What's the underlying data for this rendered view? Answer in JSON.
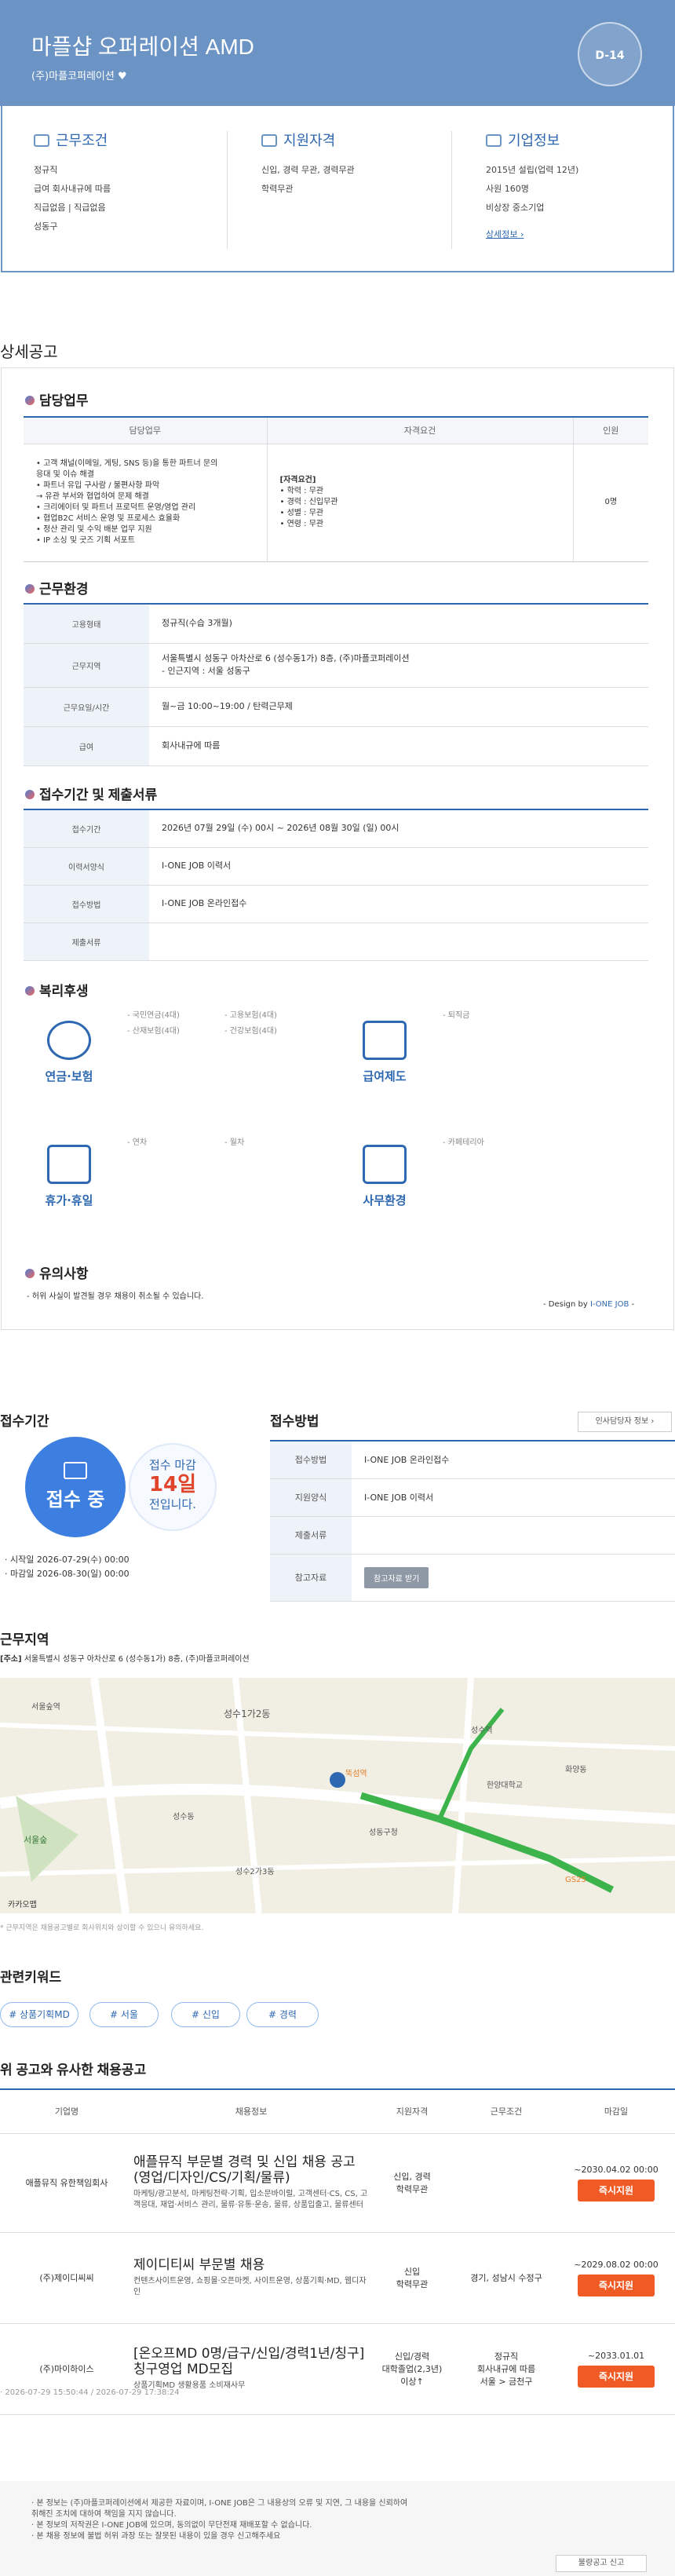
{
  "header": {
    "title": "마플샵 오퍼레이션 AMD",
    "company": "(주)마플코퍼레이션",
    "dday": "D-14"
  },
  "summary": {
    "work": {
      "title": "근무조건",
      "items": [
        "정규직",
        "급여 회사내규에 따름",
        "직급없음 | 직급없음",
        "성동구"
      ]
    },
    "qual": {
      "title": "지원자격",
      "items": [
        "신입, 경력 무관, 경력무관",
        "학력무관"
      ]
    },
    "corp": {
      "title": "기업정보",
      "items": [
        "2015년 설립(업력 12년)",
        "사원 160명",
        "비상장 중소기업"
      ],
      "link": "상세정보 ›"
    }
  },
  "detail_title": "상세공고",
  "duty": {
    "title": "담당업무",
    "headers": [
      "담당업무",
      "자격요건",
      "인원"
    ],
    "tasks": [
      "• 고객 채널(이메일, 게팅, SNS 등)을 통한 파트너 문의",
      "  응대 및 이슈 해결",
      "• 파트너 유입 구사람 / 불편사항 파악",
      "  → 유관 부서와 협업하여 문제 해결",
      "• 크리에이터 및 파트너 프로덕트 운영/영업 관리",
      "• 협업B2C 서비스 운영 및 프로세스 효율화",
      "• 정산 관리 및 수익 배분 업무 지원",
      "• IP 소싱 및 굿즈 기획 서포트"
    ],
    "reqs": [
      "[자격요건]",
      "• 학력 : 무관",
      "• 경력 : 신입무관",
      "• 성별 : 무관",
      "• 연령 : 무관"
    ],
    "count": "0명"
  },
  "env": {
    "title": "근무환경",
    "rows": [
      {
        "k": "고용형태",
        "v": "정규직(수습 3개월)"
      },
      {
        "k": "근무지역",
        "v": "서울특별시 성동구 아차산로 6 (성수동1가) 8층, (주)마플코퍼레이션",
        "v2": "- 인근지역 : 서울 성동구"
      },
      {
        "k": "근무요일/시간",
        "v": "월~금 10:00~19:00 / 탄력근무제"
      },
      {
        "k": "급여",
        "v": "회사내규에 따름"
      }
    ]
  },
  "period": {
    "title": "접수기간 및 제출서류",
    "rows": [
      {
        "k": "접수기간",
        "v": "2026년 07월 29일 (수) 00시 ~ 2026년 08월 30일 (일) 00시"
      },
      {
        "k": "이력서양식",
        "v": "I-ONE JOB 이력서"
      },
      {
        "k": "접수방법",
        "v": "I-ONE JOB 온라인접수"
      },
      {
        "k": "제출서류",
        "v": ""
      }
    ]
  },
  "welfare": {
    "title": "복리후생",
    "items": [
      {
        "label": "연금·보험",
        "notes": [
          "- 국민연금(4대)",
          "- 산재보험(4대)",
          "- 고용보험(4대)",
          "- 건강보험(4대)"
        ]
      },
      {
        "label": "급여제도",
        "notes": [
          "- 퇴직금"
        ]
      },
      {
        "label": "휴가·휴일",
        "notes": [
          "- 연차",
          "- 월차"
        ]
      },
      {
        "label": "사무환경",
        "notes": [
          "- 카페테리아"
        ]
      }
    ]
  },
  "notice": {
    "title": "유의사항",
    "text": "- 허위 사실이 발견될 경우 채용이 취소될 수 있습니다.",
    "design": "- Design by ",
    "design_brand": "I-ONE JOB",
    "design_end": " -"
  },
  "apply": {
    "period_title": "접수기간",
    "status": "접수 중",
    "deadline_pre": "접수 마감",
    "deadline_days": "14일",
    "deadline_post": "전입니다.",
    "start": "· 시작일 2026-07-29(수) 00:00",
    "end": "· 마감일 2026-08-30(일) 00:00",
    "method_title": "접수방법",
    "hr_button": "인사담당자 정보 ›",
    "rows": [
      {
        "k": "접수방법",
        "v": "I-ONE JOB 온라인접수"
      },
      {
        "k": "지원양식",
        "v": "I-ONE JOB 이력서"
      },
      {
        "k": "제출서류",
        "v": ""
      },
      {
        "k": "참고자료",
        "v": "참고자료 받기"
      }
    ]
  },
  "location": {
    "title": "근무지역",
    "address_label": "[주소]",
    "address": "서울특별시 성동구 아차산로 6 (성수동1가) 8층, (주)마플코퍼레이션",
    "map_labels": [
      "서울숲역",
      "성수1가2동",
      "성수동",
      "뚝섬역",
      "성수역",
      "서울숲",
      "응봉동",
      "세림중학교",
      "구의동",
      "화양동",
      "성동구청",
      "한양대학교",
      "성수1가1동",
      "성수2가3동",
      "GS25",
      "카카오맵"
    ],
    "note": "* 근무지역은 채용공고별로 회사위치와 상이할 수 있으니 유의하세요."
  },
  "keywords": {
    "title": "관련키워드",
    "items": [
      "# 상품기획MD",
      "# 서울",
      "# 신입",
      "# 경력"
    ]
  },
  "similar": {
    "title": "위 공고와 유사한 채용공고",
    "headers": [
      "기업명",
      "채용정보",
      "지원자격",
      "근무조건",
      "마감일"
    ],
    "rows": [
      {
        "company": "애플뮤직 유한책임회사",
        "job": "애플뮤직 부문별 경력 및 신입 채용 공고(영업/디자인/CS/기획/물류)",
        "desc": "마케팅/광고분석, 마케팅전략·기획, 입소문바이럴, 고객센터·CS, CS, 고객응대, 재업·서비스 관리, 물류·유통·운송, 물류, 상품입출고, 물류센터",
        "qual": "신입, 경력\n학력무관",
        "cond": "",
        "deadline": "~2030.04.02 00:00",
        "btn": "즉시지원"
      },
      {
        "company": "(주)제이디씨씨",
        "job": "제이디티씨 부문별 채용",
        "desc": "컨텐츠사이트운영, 쇼핑몰·오픈마켓, 사이트운영, 상품기획·MD, 웹디자인",
        "qual": "신입\n학력무관",
        "cond": "경기, 성남시 수정구",
        "deadline": "~2029.08.02 00:00",
        "btn": "즉시지원"
      },
      {
        "company": "(주)마이하이스",
        "job": "[온오프MD 0명/급구/신입/경력1년/칭구] 칭구영업 MD모집",
        "desc": "상품기획MD 생활용품 소비재사무",
        "qual": "신입/경력\n대학졸업(2,3년)\n이상↑",
        "cond": "정규직\n회사내규에 따름\n서울 > 금천구",
        "deadline": "~2033.01.01",
        "btn": "즉시지원"
      }
    ]
  },
  "timestamps": "· 2026-07-29 15:50:44 / 2026-07-29 17:38:24",
  "footer": {
    "lines": [
      "· 본 정보는 (주)마플코퍼레이션에서 제공한 자료이며, I-ONE JOB은 그 내용상의 오류 및 지연, 그 내용을 신뢰하여",
      "  취해진 조치에 대하여 책임을 지지 않습니다.",
      "· 본 정보의 저작권은 I-ONE JOB에 있으며, 동의없이 무단전재 재배포할 수 없습니다.",
      "· 본 채용 정보에 불법 허위 과장 또는 잘못된 내용이 있을 경우 신고해주세요"
    ],
    "report": "불량공고 신고"
  },
  "colors": {
    "primary": "#2e68b1",
    "header": "#6b93c4",
    "apply": "#f05a24",
    "dday_red": "#e0452b"
  }
}
